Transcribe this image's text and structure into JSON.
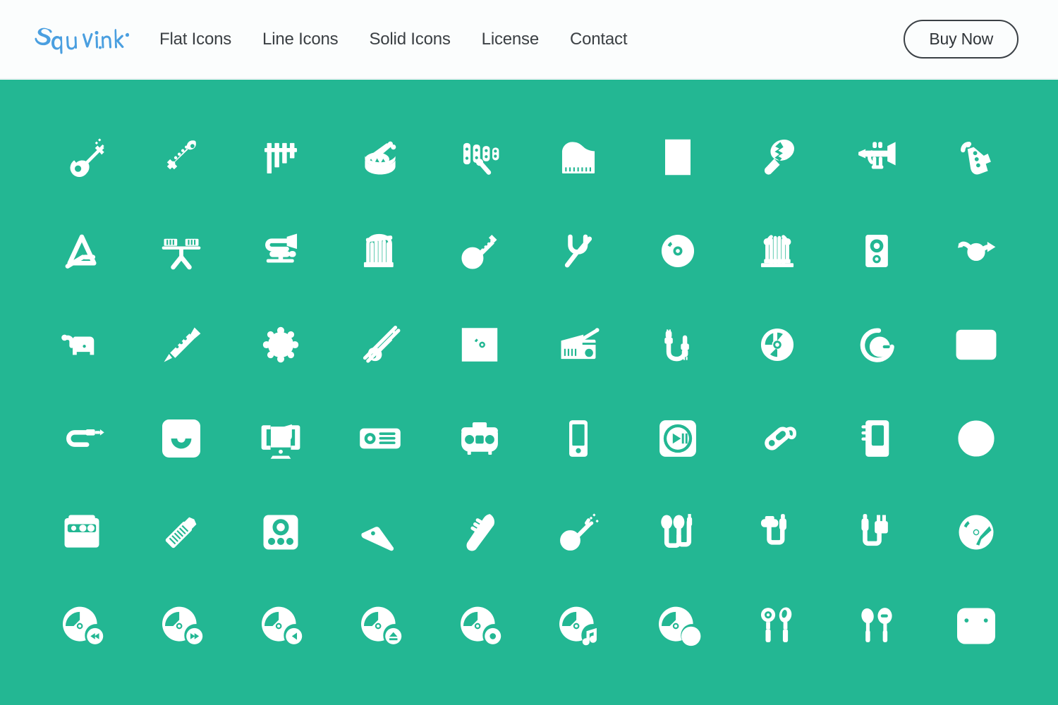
{
  "site": {
    "logo_text": "Squid.ink",
    "brand_color": "#4a9fe0",
    "board_color": "#23b793",
    "header_bg": "#fbfdfd"
  },
  "header": {
    "nav": [
      {
        "label": "Flat Icons",
        "name": "nav-flat-icons"
      },
      {
        "label": "Line Icons",
        "name": "nav-line-icons"
      },
      {
        "label": "Solid Icons",
        "name": "nav-solid-icons"
      },
      {
        "label": "License",
        "name": "nav-license"
      },
      {
        "label": "Contact",
        "name": "nav-contact"
      }
    ],
    "buy_button": "Buy Now"
  },
  "icon_grid": {
    "columns": 10,
    "rows": 6,
    "count": 60,
    "icons": [
      {
        "id": "acoustic-guitar",
        "label": "Acoustic Guitar"
      },
      {
        "id": "electric-guitar-headstock",
        "label": "Electric Guitar Headstock"
      },
      {
        "id": "pan-flute",
        "label": "Pan Flute"
      },
      {
        "id": "snare-drum",
        "label": "Snare Drum"
      },
      {
        "id": "xylophone",
        "label": "Xylophone"
      },
      {
        "id": "grand-piano",
        "label": "Grand Piano"
      },
      {
        "id": "piano-keys",
        "label": "Piano Keys"
      },
      {
        "id": "maraca",
        "label": "Maraca"
      },
      {
        "id": "trumpet",
        "label": "Trumpet"
      },
      {
        "id": "saxophone",
        "label": "Saxophone"
      },
      {
        "id": "triangle-instrument",
        "label": "Triangle"
      },
      {
        "id": "drum-kit-stand",
        "label": "Drum Kit Stand"
      },
      {
        "id": "trombone",
        "label": "Trombone"
      },
      {
        "id": "harp",
        "label": "Harp"
      },
      {
        "id": "banjo",
        "label": "Banjo"
      },
      {
        "id": "tuning-fork",
        "label": "Tuning Fork"
      },
      {
        "id": "vinyl-record",
        "label": "Vinyl Record"
      },
      {
        "id": "lyre",
        "label": "Lyre"
      },
      {
        "id": "speaker-tower",
        "label": "Speaker"
      },
      {
        "id": "french-horn",
        "label": "French Horn"
      },
      {
        "id": "gramophone",
        "label": "Gramophone"
      },
      {
        "id": "clarinet",
        "label": "Clarinet"
      },
      {
        "id": "tambourine",
        "label": "Tambourine"
      },
      {
        "id": "violin-bow",
        "label": "Violin and Bow"
      },
      {
        "id": "cd-case",
        "label": "CD Case"
      },
      {
        "id": "radio",
        "label": "Radio"
      },
      {
        "id": "audio-cable-plugs",
        "label": "Audio Cable"
      },
      {
        "id": "cd-disc",
        "label": "CD Disc"
      },
      {
        "id": "disc-minus",
        "label": "Disc Minus"
      },
      {
        "id": "cassette-tape",
        "label": "Cassette Tape"
      },
      {
        "id": "aux-cable",
        "label": "Aux Cable"
      },
      {
        "id": "cd-player-square",
        "label": "CD Player"
      },
      {
        "id": "desktop-music",
        "label": "Desktop Music"
      },
      {
        "id": "boombox-stereo",
        "label": "Stereo"
      },
      {
        "id": "portable-boombox",
        "label": "Portable Boombox"
      },
      {
        "id": "mobile-player",
        "label": "Mobile Music Player"
      },
      {
        "id": "play-pause-player",
        "label": "Play Pause Player"
      },
      {
        "id": "mp3-player-clip",
        "label": "MP3 Player"
      },
      {
        "id": "voice-recorder",
        "label": "Voice Recorder"
      },
      {
        "id": "soundwave-circle",
        "label": "Sound Wave"
      },
      {
        "id": "amplifier",
        "label": "Amplifier"
      },
      {
        "id": "keytar",
        "label": "Keytar"
      },
      {
        "id": "drum-machine",
        "label": "Drum Machine"
      },
      {
        "id": "guitar-pick-tool",
        "label": "Tuning Key"
      },
      {
        "id": "conga-drum",
        "label": "Conga Drum"
      },
      {
        "id": "banjolele",
        "label": "Banjolele"
      },
      {
        "id": "earbuds-jack",
        "label": "Earbuds with Jack"
      },
      {
        "id": "headphone-adapter",
        "label": "Headphone Adapter"
      },
      {
        "id": "usb-audio-cable",
        "label": "USB Audio Cable"
      },
      {
        "id": "turntable-disc",
        "label": "Turntable"
      },
      {
        "id": "disc-rewind",
        "label": "Disc Rewind"
      },
      {
        "id": "disc-fast-forward",
        "label": "Disc Fast Forward"
      },
      {
        "id": "disc-previous",
        "label": "Disc Previous"
      },
      {
        "id": "disc-eject",
        "label": "Disc Eject"
      },
      {
        "id": "disc-record",
        "label": "Disc Record"
      },
      {
        "id": "disc-music-note",
        "label": "Disc Music"
      },
      {
        "id": "disc-pause",
        "label": "Disc Pause"
      },
      {
        "id": "earphones-pair",
        "label": "Earphones"
      },
      {
        "id": "earpods",
        "label": "Earpods"
      },
      {
        "id": "earphones-case",
        "label": "Earphones Case"
      }
    ]
  }
}
